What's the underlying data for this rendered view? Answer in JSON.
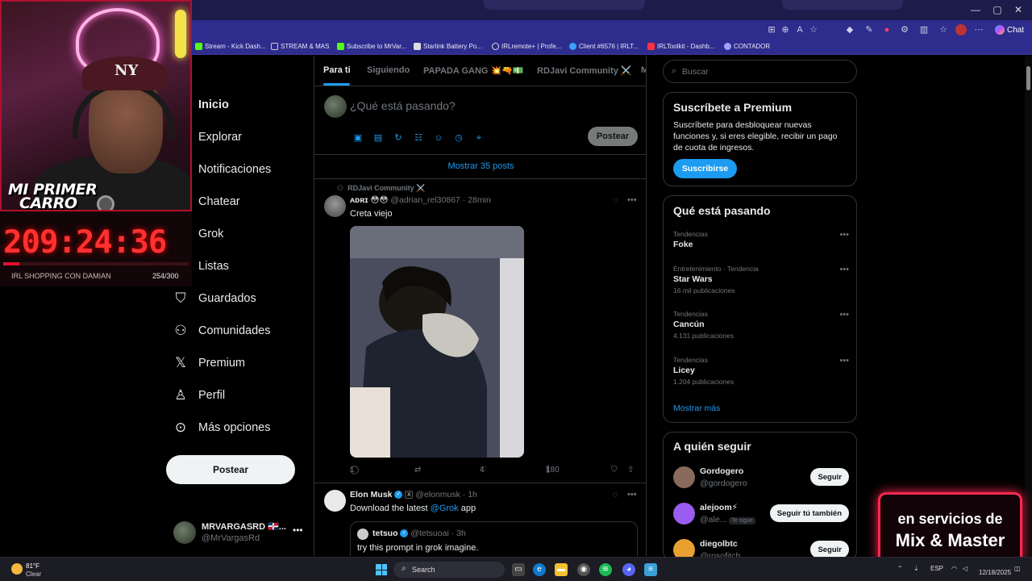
{
  "browser": {
    "bookmarks": [
      {
        "label": "Stream - Kick Dash...",
        "color": "#53fc18"
      },
      {
        "label": "STREAM & MAS",
        "color": "#cccccc"
      },
      {
        "label": "Subscribe to MrVar...",
        "color": "#53fc18"
      },
      {
        "label": "Starlink Battery Po...",
        "color": "#dddddd"
      },
      {
        "label": "IRLremote+ | Profe...",
        "color": "#dddddd"
      },
      {
        "label": "Client #6576 | IRLT...",
        "color": "#3aa0ff"
      },
      {
        "label": "IRLToolkit - Dashb...",
        "color": "#ff3040"
      },
      {
        "label": "CONTADOR",
        "color": "#e0e0ff"
      }
    ],
    "chat_label": "Chat"
  },
  "nav": {
    "items": [
      {
        "label": "Inicio",
        "icon": "home-icon"
      },
      {
        "label": "Explorar",
        "icon": "search-icon"
      },
      {
        "label": "Notificaciones",
        "icon": "bell-icon"
      },
      {
        "label": "Chatear",
        "icon": "mail-icon"
      },
      {
        "label": "Grok",
        "icon": "grok-icon"
      },
      {
        "label": "Listas",
        "icon": "list-icon"
      },
      {
        "label": "Guardados",
        "icon": "bookmark-icon"
      },
      {
        "label": "Comunidades",
        "icon": "people-icon"
      },
      {
        "label": "Premium",
        "icon": "x-logo-icon"
      },
      {
        "label": "Perfil",
        "icon": "person-icon"
      },
      {
        "label": "Más opciones",
        "icon": "more-circle-icon"
      }
    ],
    "post_button": "Postear",
    "user": {
      "name": "MRVARGASRD 🇩🇴...",
      "handle": "@MrVargasRd"
    }
  },
  "feed": {
    "tabs": [
      "Para ti",
      "Siguiendo",
      "PAPADA GANG 💥🔫💵",
      "RDJavi Community ⚔️",
      "M"
    ],
    "compose": {
      "placeholder": "¿Qué está pasando?",
      "post_button": "Postear"
    },
    "show_posts": "Mostrar 35 posts",
    "post1": {
      "context": "RDJavi Community ⚔️",
      "name": "ᴀᴅʀɪ 😳😳",
      "handle": "@adrian_rel30867 · 28min",
      "text": "Creta viejo",
      "replies": "1",
      "likes": "4",
      "views": "180"
    },
    "post2": {
      "name": "Elon Musk",
      "handle": "@elonmusk · 1h",
      "text_before": "Download the latest ",
      "text_link": "@Grok",
      "text_after": " app",
      "quote": {
        "name": "tetsuo",
        "handle": "@tetsuoai · 3h",
        "text": "try this prompt in grok imagine."
      }
    }
  },
  "sidebar": {
    "search_placeholder": "Buscar",
    "premium": {
      "title": "Suscríbete a Premium",
      "text": "Suscríbete para desbloquear nuevas funciones y, si eres elegible, recibir un pago de cuota de ingresos.",
      "button": "Suscribirse"
    },
    "trends": {
      "title": "Qué está pasando",
      "items": [
        {
          "category": "Tendencias",
          "name": "Foke",
          "count": ""
        },
        {
          "category": "Entretenimiento · Tendencia",
          "name": "Star Wars",
          "count": "16 mil publicaciones"
        },
        {
          "category": "Tendencias",
          "name": "Cancún",
          "count": "4.131 publicaciones"
        },
        {
          "category": "Tendencias",
          "name": "Licey",
          "count": "1.204 publicaciones"
        }
      ],
      "more": "Mostrar más"
    },
    "follow": {
      "title": "A quién seguir",
      "items": [
        {
          "name": "Gordogero",
          "handle": "@gordogero",
          "tag": "",
          "button": "Seguir",
          "color": "#8a6a5a"
        },
        {
          "name": "alejoom⚡",
          "handle": "@ale...",
          "tag": "Te sigue",
          "button": "Seguir tú también",
          "color": "#9b5cf0"
        },
        {
          "name": "diegolbtc",
          "handle": "@rosofitch",
          "tag": "",
          "button": "Seguir",
          "color": "#e8a030"
        }
      ]
    }
  },
  "overlay": {
    "car_title_1": "MI PRIMER",
    "car_title_2": "CARRO",
    "timer": "209:24:36",
    "goal_label": "IRL SHOPPING CON DAMIAN",
    "goal_count": "254/300",
    "goal_progress": 0.085,
    "promo_line1": "en servicios de",
    "promo_line2": "Mix & Master"
  },
  "taskbar": {
    "temp": "81°F",
    "condition": "Clear",
    "search": "Search",
    "lang": "ESP",
    "date": "12/18/2025"
  }
}
